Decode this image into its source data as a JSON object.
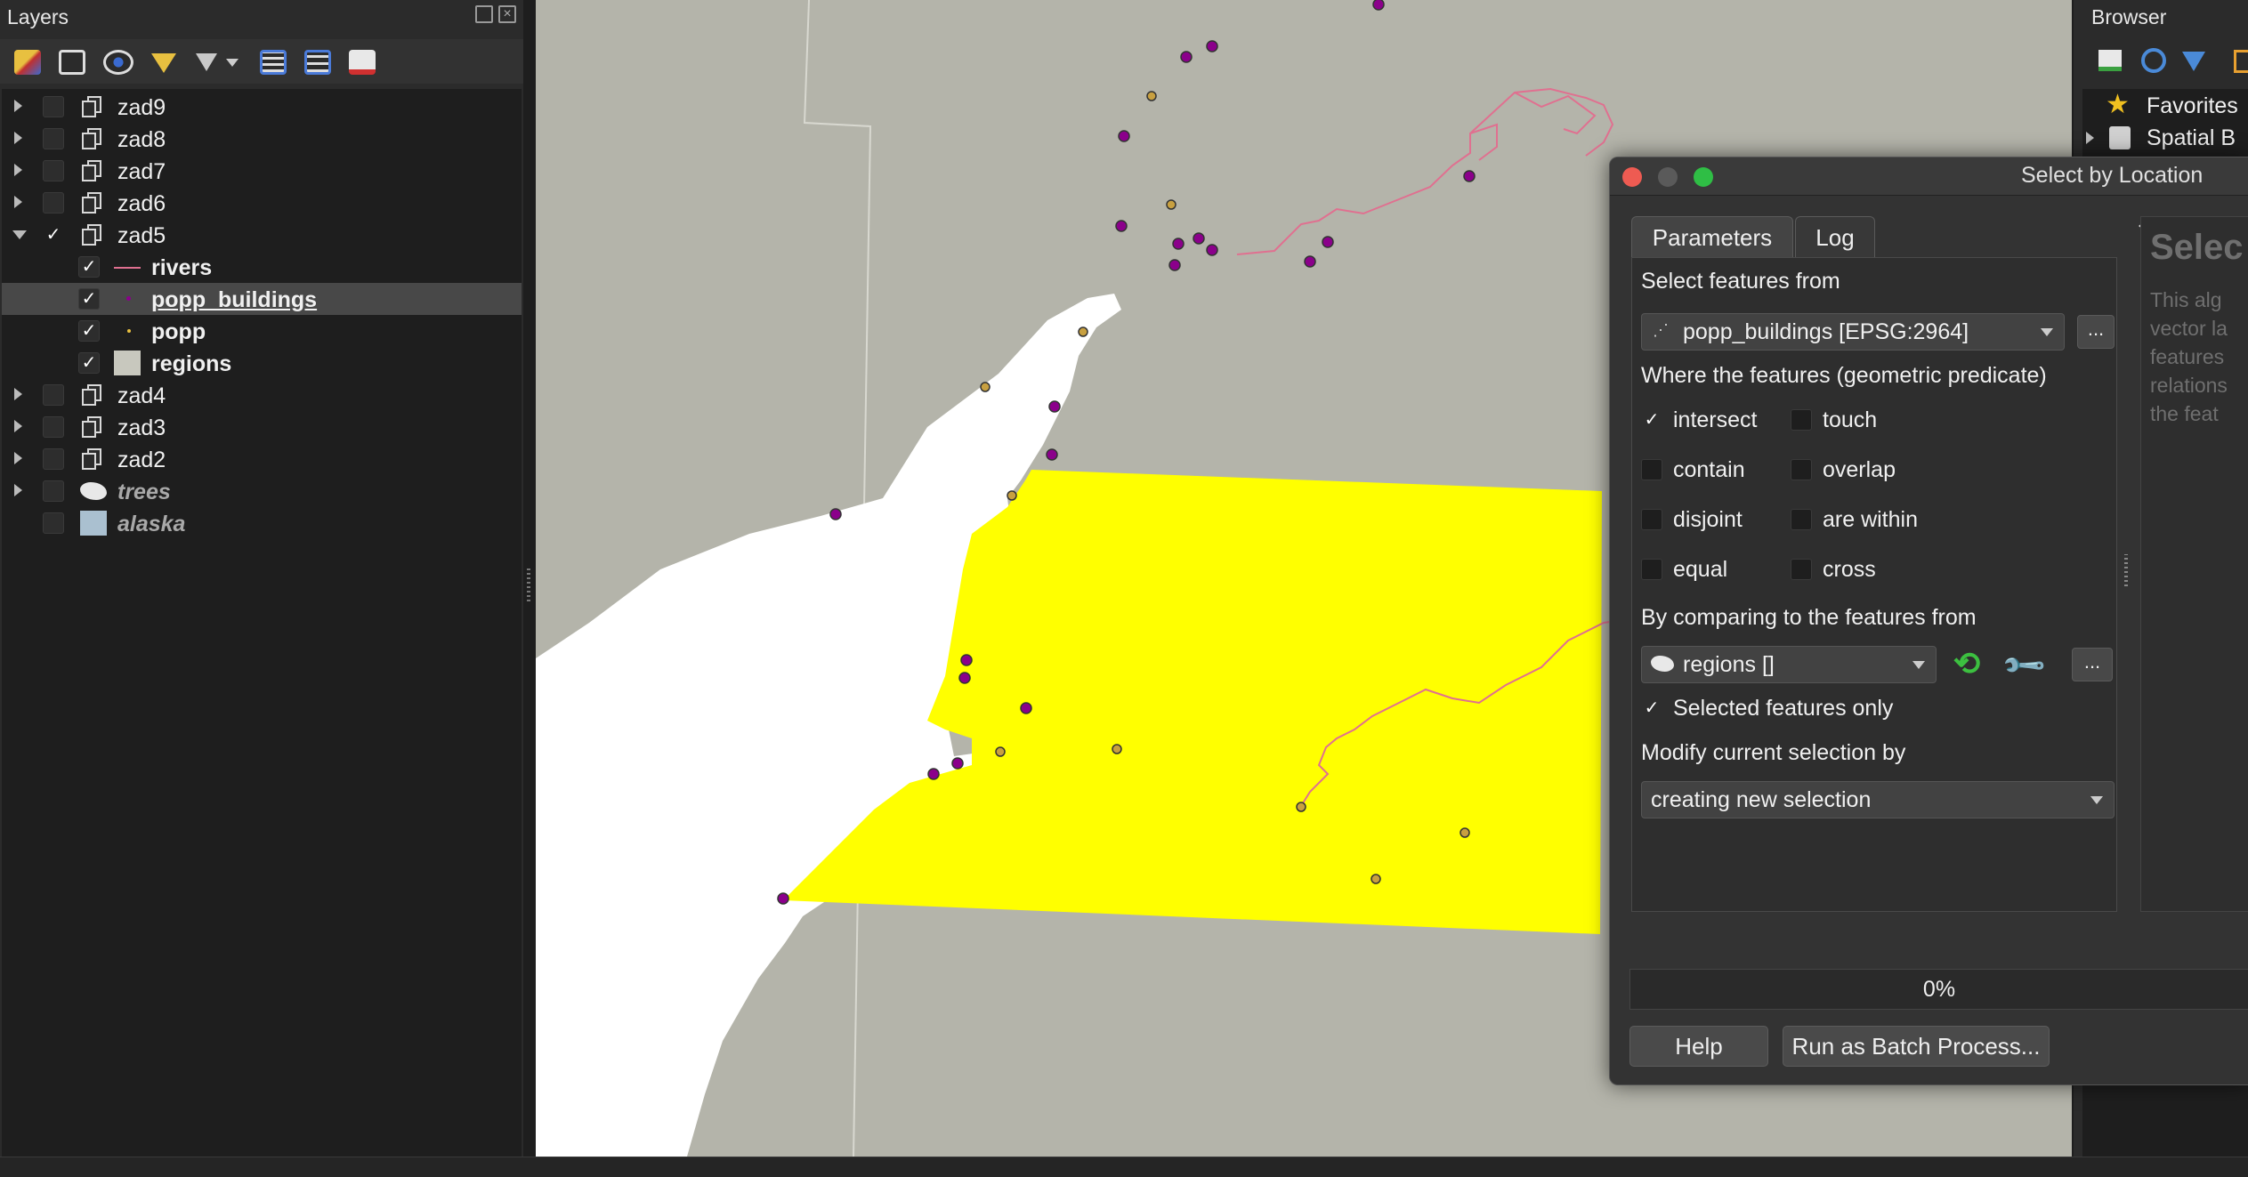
{
  "layers_panel": {
    "title": "Layers",
    "toolbar_icons": [
      "open-layer-styling-icon",
      "add-group-icon",
      "manage-visibility-icon",
      "filter-legend-icon",
      "filter-by-expression-icon",
      "expand-all-icon",
      "collapse-all-icon",
      "remove-layer-icon"
    ],
    "items": [
      {
        "label": "zad9",
        "type": "group",
        "checked": false,
        "expanded": false
      },
      {
        "label": "zad8",
        "type": "group",
        "checked": false,
        "expanded": false
      },
      {
        "label": "zad7",
        "type": "group",
        "checked": false,
        "expanded": false
      },
      {
        "label": "zad6",
        "type": "group",
        "checked": false,
        "expanded": false
      },
      {
        "label": "zad5",
        "type": "group",
        "checked": true,
        "expanded": true
      },
      {
        "label": "rivers",
        "type": "line-layer",
        "checked": true
      },
      {
        "label": "popp_buildings",
        "type": "point-layer",
        "checked": true,
        "selected": true
      },
      {
        "label": "popp",
        "type": "point-layer",
        "checked": true
      },
      {
        "label": "regions",
        "type": "polygon-layer",
        "checked": true
      },
      {
        "label": "zad4",
        "type": "group",
        "checked": false,
        "expanded": false
      },
      {
        "label": "zad3",
        "type": "group",
        "checked": false,
        "expanded": false
      },
      {
        "label": "zad2",
        "type": "group",
        "checked": false,
        "expanded": false
      },
      {
        "label": "trees",
        "type": "polygon-layer",
        "checked": false
      },
      {
        "label": "alaska",
        "type": "polygon-layer",
        "checked": false
      }
    ]
  },
  "browser_panel": {
    "title": "Browser",
    "items": [
      {
        "label": "Favorites",
        "icon": "star-icon"
      },
      {
        "label": "Spatial B",
        "icon": "database-icon"
      }
    ]
  },
  "dialog": {
    "title": "Select by Location",
    "tabs": {
      "parameters": "Parameters",
      "log": "Log"
    },
    "select_from_label": "Select features from",
    "select_from_value": "popp_buildings [EPSG:2964]",
    "ellipsis": "...",
    "predicate_label": "Where the features (geometric predicate)",
    "predicates": {
      "intersect": {
        "label": "intersect",
        "checked": true
      },
      "touch": {
        "label": "touch",
        "checked": false
      },
      "contain": {
        "label": "contain",
        "checked": false
      },
      "overlap": {
        "label": "overlap",
        "checked": false
      },
      "disjoint": {
        "label": "disjoint",
        "checked": false
      },
      "are_within": {
        "label": "are within",
        "checked": false
      },
      "equal": {
        "label": "equal",
        "checked": false
      },
      "cross": {
        "label": "cross",
        "checked": false
      }
    },
    "compare_label": "By comparing to the features from",
    "compare_value": "regions []",
    "selected_only": {
      "label": "Selected features only",
      "checked": true
    },
    "modify_label": "Modify current selection by",
    "modify_value": "creating new selection",
    "help": {
      "heading": "Selec",
      "lines": [
        "This alg",
        "vector la",
        "features",
        "relations",
        "the feat"
      ]
    },
    "progress": "0%",
    "help_button": "Help",
    "batch_button": "Run as Batch Process..."
  },
  "colors": {
    "map_background": "#b4b4aa",
    "selection_yellow": "#ffff00",
    "building_point": "#8b008b",
    "popp_point": "#c8a040",
    "river": "#e07090",
    "land_white": "#ffffff"
  }
}
